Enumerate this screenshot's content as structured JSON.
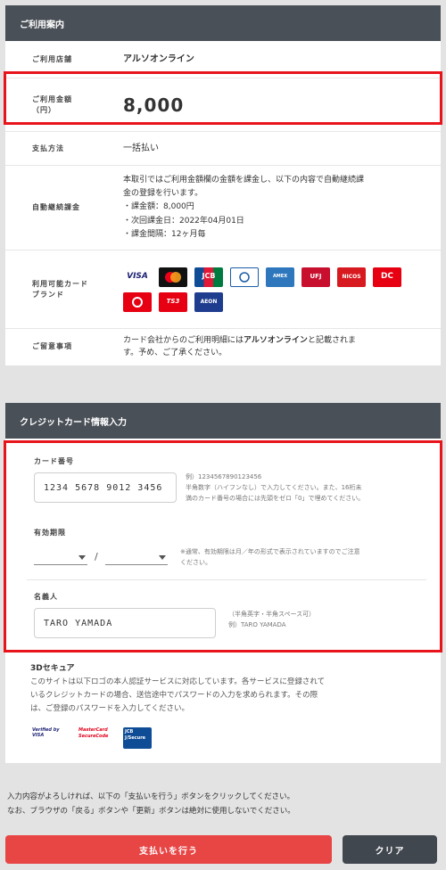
{
  "usage": {
    "header": "ご利用案内",
    "store_label": "ご利用店舗",
    "store_value": "アルソオンライン",
    "amount_label": "ご利用金額\n（円）",
    "amount_value": "8,000",
    "payment_label": "支払方法",
    "payment_value": "一括払い",
    "auto_label": "自動継続課金",
    "auto_text_1": "本取引ではご利用金額欄の金額を課金し、以下の内容で自動継続課",
    "auto_text_2": "金の登録を行います。",
    "auto_item_1": "・課金額：8,000円",
    "auto_item_2": "・次回課金日：2022年04月01日",
    "auto_item_3": "・課金間隔：12ヶ月毎",
    "brands_label": "利用可能カード\nブランド",
    "brands": [
      "VISA",
      "mastercard",
      "JCB",
      "Diners Club",
      "AMERICAN EXPRESS",
      "UFJ",
      "NICOS",
      "DC",
      "Saison",
      "TS3",
      "AEON"
    ],
    "notes_label": "ご留意事項",
    "notes_text_1": "カード会社からのご利用明細には",
    "notes_bold": "アルソオンライン",
    "notes_text_2": "と記載されま",
    "notes_text_3": "す。予め、ご了承ください。"
  },
  "card": {
    "header": "クレジットカード情報入力",
    "number_label": "カード番号",
    "number_value": "1234 5678 9012 3456",
    "number_note_1": "例）1234567890123456",
    "number_note_2": "半角数字（ハイフンなし）で入力してください。また、16桁未",
    "number_note_3": "満のカード番号の場合には先頭をゼロ「0」で埋めてください。",
    "expiry_label": "有効期限",
    "expiry_sep": "/",
    "expiry_note_1": "※通常、有効期限は月／年の形式で表示されていますのでご注意",
    "expiry_note_2": "ください。",
    "holder_label": "名義人",
    "holder_value": "TARO YAMADA",
    "holder_note_1": "（半角英字・半角スペース可）",
    "holder_note_2": "例）TARO YAMADA",
    "secure_label": "3Dセキュア",
    "secure_text_1": "このサイトは以下ロゴの本人認証サービスに対応しています。各サービスに登録されて",
    "secure_text_2": "いるクレジットカードの場合、送信途中でパスワードの入力を求められます。その際",
    "secure_text_3": "は、ご登録のパスワードを入力してください。",
    "secure_logos": [
      "Verified by VISA",
      "MasterCard SecureCode",
      "JCB J/Secure"
    ]
  },
  "footer": {
    "notice_1": "入力内容がよろしければ、以下の「支払いを行う」ボタンをクリックしてください。",
    "notice_2": "なお、ブラウザの「戻る」ボタンや「更新」ボタンは絶対に使用しないでください。",
    "pay_button": "支払いを行う",
    "clear_button": "クリア"
  },
  "colors": {
    "header": "#4a5058",
    "highlight": "#e8141c",
    "pay": "#e84545",
    "clear": "#41474f"
  }
}
